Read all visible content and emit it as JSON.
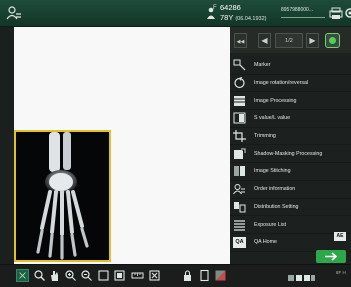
{
  "header": {
    "patient_sex": "F",
    "patient_id": "64286",
    "patient_age": "78Y",
    "patient_dob": "(06.04.1932)",
    "accession": "8957988000..."
  },
  "navigator": {
    "prev_first": "◀◀",
    "prev": "◀",
    "page": "1/2",
    "next": "▶",
    "next_last": "▶▶"
  },
  "menu": {
    "items": [
      {
        "label": "Marker",
        "icon": "marker-icon"
      },
      {
        "label": "Image rotation/reversal",
        "icon": "rotation-icon"
      },
      {
        "label": "Image Processing",
        "icon": "processing-icon"
      },
      {
        "label": "S value/L value",
        "icon": "s-value-icon"
      },
      {
        "label": "Trimming",
        "icon": "trimming-icon"
      },
      {
        "label": "Shadow-Masking Processing",
        "icon": "shadow-masking-icon"
      },
      {
        "label": "Image Stitching",
        "icon": "stitching-icon"
      },
      {
        "label": "Order information",
        "icon": "order-info-icon"
      },
      {
        "label": "Distribution Setting",
        "icon": "distribution-icon"
      },
      {
        "label": "Exposure List",
        "icon": "exposure-list-icon"
      },
      {
        "label": "QA Home",
        "icon": "qa-home-icon"
      }
    ],
    "qa_badge": "QA",
    "ae_chip": "AE"
  },
  "status": {
    "text": "8F H"
  },
  "colors": {
    "topbar": "#1e4c3a",
    "accent_green": "#2ea64a",
    "thumb_border": "#e2c02a"
  }
}
